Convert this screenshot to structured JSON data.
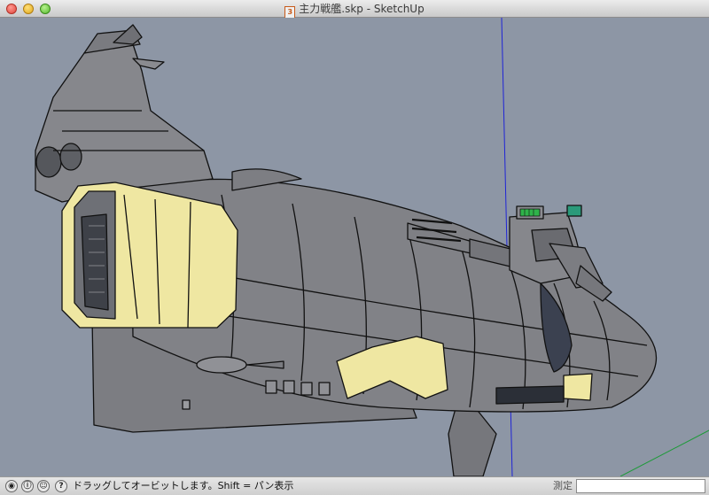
{
  "window": {
    "title": "主力戦艦.skp - SketchUp",
    "doc_icon_glyph": "3"
  },
  "viewport": {
    "background": "#8d96a5",
    "model_fill": "#7f8085",
    "accent_yellow": "#efe7a2",
    "axis_blue": "#1f24d6",
    "axis_green": "#1f9a3a"
  },
  "statusbar": {
    "icons": [
      "geolocation-icon",
      "credits-icon",
      "user-icon",
      "help-icon"
    ],
    "help_glyph": "?",
    "message": "ドラッグしてオービットします。Shift = パン表示",
    "measure_label": "測定",
    "measure_value": ""
  }
}
